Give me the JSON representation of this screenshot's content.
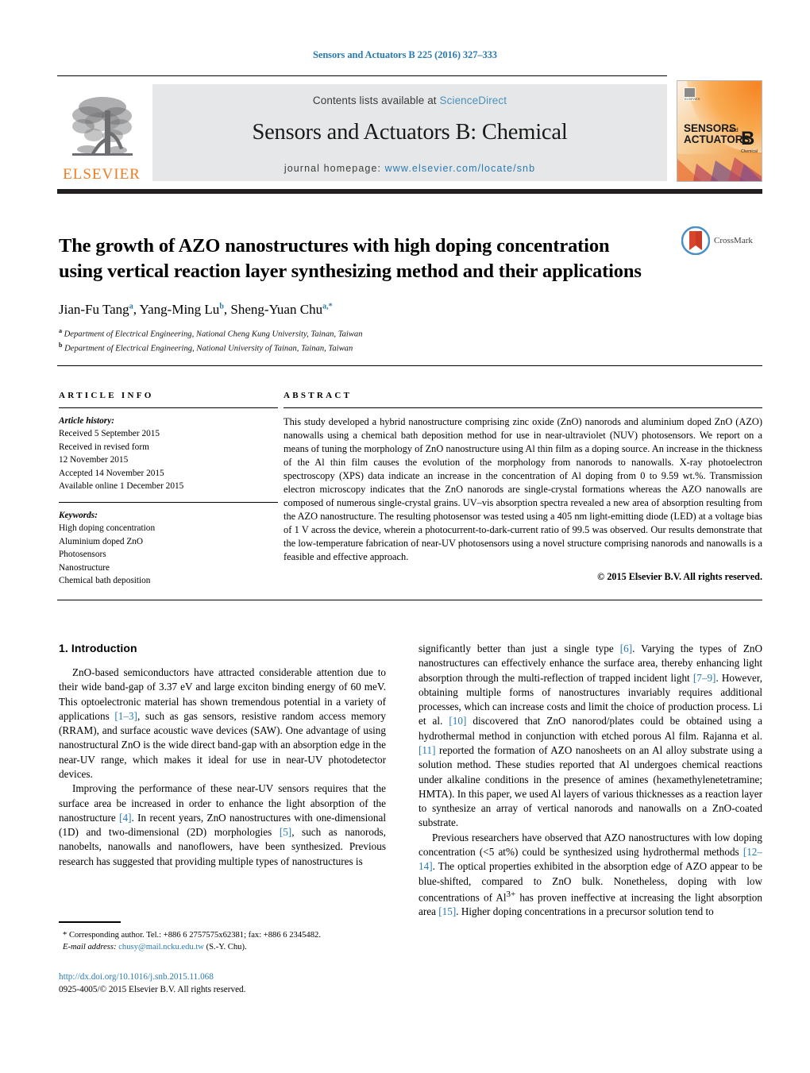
{
  "running_head": "Sensors and Actuators B 225 (2016) 327–333",
  "masthead": {
    "contents_prefix": "Contents lists available at ",
    "sciencedirect": "ScienceDirect",
    "journal_title": "Sensors and Actuators B: Chemical",
    "homepage_prefix": "journal homepage: ",
    "homepage_url": "www.elsevier.com/locate/snb",
    "publisher": "ELSEVIER",
    "cover_line1": "SENSORS",
    "cover_and": "and",
    "cover_line2": "ACTUATORS",
    "cover_letter": "B",
    "cover_sub": "Chemical"
  },
  "article": {
    "title": "The growth of AZO nanostructures with high doping concentration using vertical reaction layer synthesizing method and their applications",
    "crossmark_label": "CrossMark",
    "authors_html": "Jian-Fu Tang<sup>a</sup>, Yang-Ming Lu<sup>b</sup>, Sheng-Yuan Chu<sup>a,*</sup>",
    "affiliation_a": "Department of Electrical Engineering, National Cheng Kung University, Tainan, Taiwan",
    "affiliation_b": "Department of Electrical Engineering, National University of Tainan, Tainan, Taiwan"
  },
  "article_info": {
    "heading": "ARTICLE INFO",
    "history_label": "Article history:",
    "history": [
      "Received 5 September 2015",
      "Received in revised form",
      "12 November 2015",
      "Accepted 14 November 2015",
      "Available online 1 December 2015"
    ],
    "keywords_label": "Keywords:",
    "keywords": [
      "High doping concentration",
      "Aluminium doped ZnO",
      "Photosensors",
      "Nanostructure",
      "Chemical bath deposition"
    ]
  },
  "abstract": {
    "heading": "ABSTRACT",
    "text": "This study developed a hybrid nanostructure comprising zinc oxide (ZnO) nanorods and aluminium doped ZnO (AZO) nanowalls using a chemical bath deposition method for use in near-ultraviolet (NUV) photosensors. We report on a means of tuning the morphology of ZnO nanostructure using Al thin film as a doping source. An increase in the thickness of the Al thin film causes the evolution of the morphology from nanorods to nanowalls. X-ray photoelectron spectroscopy (XPS) data indicate an increase in the concentration of Al doping from 0 to 9.59 wt.%. Transmission electron microscopy indicates that the ZnO nanorods are single-crystal formations whereas the AZO nanowalls are composed of numerous single-crystal grains. UV–vis absorption spectra revealed a new area of absorption resulting from the AZO nanostructure. The resulting photosensor was tested using a 405 nm light-emitting diode (LED) at a voltage bias of 1 V across the device, wherein a photocurrent-to-dark-current ratio of 99.5 was observed. Our results demonstrate that the low-temperature fabrication of near-UV photosensors using a novel structure comprising nanorods and nanowalls is a feasible and effective approach.",
    "copyright": "© 2015 Elsevier B.V. All rights reserved."
  },
  "body": {
    "section_heading": "1.  Introduction",
    "left_paragraphs": [
      "ZnO-based semiconductors have attracted considerable attention due to their wide band-gap of 3.37 eV and large exciton binding energy of 60 meV. This optoelectronic material has shown tremendous potential in a variety of applications <span class=\"ref\">[1–3]</span>, such as gas sensors, resistive random access memory (RRAM), and surface acoustic wave devices (SAW). One advantage of using nanostructural ZnO is the wide direct band-gap with an absorption edge in the near-UV range, which makes it ideal for use in near-UV photodetector devices.",
      "Improving the performance of these near-UV sensors requires that the surface area be increased in order to enhance the light absorption of the nanostructure <span class=\"ref\">[4]</span>. In recent years, ZnO nanostructures with one-dimensional (1D) and two-dimensional (2D) morphologies <span class=\"ref\">[5]</span>, such as nanorods, nanobelts, nanowalls and nanoflowers, have been synthesized. Previous research has suggested that providing multiple types of nanostructures is"
    ],
    "right_paragraphs": [
      "significantly better than just a single type <span class=\"ref\">[6]</span>. Varying the types of ZnO nanostructures can effectively enhance the surface area, thereby enhancing light absorption through the multi-reflection of trapped incident light <span class=\"ref\">[7–9]</span>. However, obtaining multiple forms of nanostructures invariably requires additional processes, which can increase costs and limit the choice of production process. Li et al. <span class=\"ref\">[10]</span> discovered that ZnO nanorod/plates could be obtained using a hydrothermal method in conjunction with etched porous Al film. Rajanna et al. <span class=\"ref\">[11]</span> reported the formation of AZO nanosheets on an Al alloy substrate using a solution method. These studies reported that Al undergoes chemical reactions under alkaline conditions in the presence of amines (hexamethylenetetramine; HMTA). In this paper, we used Al layers of various thicknesses as a reaction layer to synthesize an array of vertical nanorods and nanowalls on a ZnO-coated substrate.",
      "Previous researchers have observed that AZO nanostructures with low doping concentration (&lt;5 at%) could be synthesized using hydrothermal methods <span class=\"ref\">[12–14]</span>. The optical properties exhibited in the absorption edge of AZO appear to be blue-shifted, compared to ZnO bulk. Nonetheless, doping with low concentrations of Al<sup>3+</sup> has proven ineffective at increasing the light absorption area <span class=\"ref\">[15]</span>. Higher doping concentrations in a precursor solution tend to"
    ]
  },
  "footnote": {
    "corresponding": "*  Corresponding author. Tel.: +886 6 2757575x62381; fax: +886 6 2345482.",
    "email_label": "E-mail address:",
    "email": "chusy@mail.ncku.edu.tw",
    "email_suffix": "(S.-Y. Chu)."
  },
  "footer": {
    "doi": "http://dx.doi.org/10.1016/j.snb.2015.11.068",
    "issn": "0925-4005/© 2015 Elsevier B.V. All rights reserved."
  },
  "colors": {
    "link_blue": "#2a7ab0",
    "elsevier_orange": "#f07d20",
    "panel_gray": "#e6e7e8",
    "rule_black": "#231f20"
  }
}
